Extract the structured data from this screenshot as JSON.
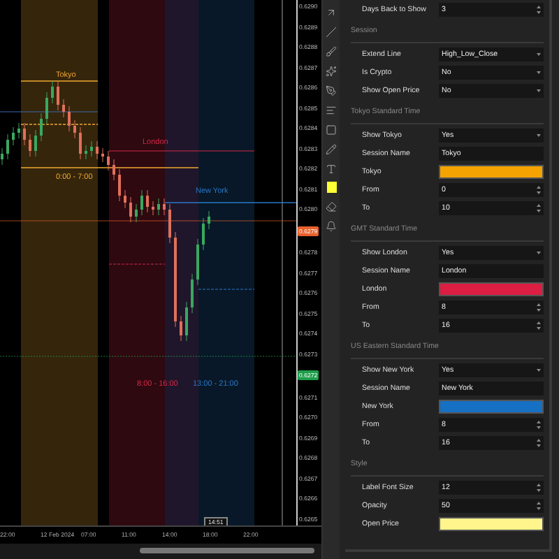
{
  "chart": {
    "sessions": [
      {
        "name": "Tokyo",
        "range": "0:00 - 7:00",
        "color": "#f0a830"
      },
      {
        "name": "London",
        "range": "8:00 - 16:00",
        "color": "#d02848"
      },
      {
        "name": "New York",
        "range": "13:00 - 21:00",
        "color": "#2a78c8"
      }
    ],
    "price_axis": [
      {
        "kind": "tick",
        "text": "0.6290"
      },
      {
        "kind": "tick",
        "text": "0.6289"
      },
      {
        "kind": "tick",
        "text": "0.6288"
      },
      {
        "kind": "tick",
        "text": "0.6287"
      },
      {
        "kind": "tick",
        "text": "0.6286"
      },
      {
        "kind": "tick",
        "text": "0.6285"
      },
      {
        "kind": "tick",
        "text": "0.6284"
      },
      {
        "kind": "tick",
        "text": "0.6283"
      },
      {
        "kind": "tick",
        "text": "0.6282"
      },
      {
        "kind": "tick",
        "text": "0.6281"
      },
      {
        "kind": "tick",
        "text": "0.6280"
      },
      {
        "kind": "badge",
        "text": "0.6279",
        "color": "#e8602c"
      },
      {
        "kind": "tick",
        "text": "0.6278"
      },
      {
        "kind": "tick",
        "text": "0.6277"
      },
      {
        "kind": "tick",
        "text": "0.6276"
      },
      {
        "kind": "tick",
        "text": "0.6275"
      },
      {
        "kind": "tick",
        "text": "0.6274"
      },
      {
        "kind": "tick",
        "text": "0.6273"
      },
      {
        "kind": "badge",
        "text": "0.6272",
        "color": "#1e9e4a"
      },
      {
        "kind": "tick",
        "text": "0.6271"
      },
      {
        "kind": "tick",
        "text": "0.6270"
      },
      {
        "kind": "tick",
        "text": "0.6269"
      },
      {
        "kind": "tick",
        "text": "0.6268"
      },
      {
        "kind": "tick",
        "text": "0.6267"
      },
      {
        "kind": "tick",
        "text": "0.6266"
      },
      {
        "kind": "tick",
        "text": "0.6265"
      }
    ],
    "time_axis": [
      "22:00",
      "12 Feb 2024",
      "07:00",
      "11:00",
      "14:00",
      "18:00",
      "22:00"
    ],
    "cursor_time": "14:51"
  },
  "settings": [
    {
      "kind": "number",
      "label": "Days Back to Show",
      "value": "3"
    },
    {
      "kind": "section",
      "label": "Session"
    },
    {
      "kind": "select",
      "label": "Extend Line",
      "value": "High_Low_Close"
    },
    {
      "kind": "select",
      "label": "Is Crypto",
      "value": "No"
    },
    {
      "kind": "select",
      "label": "Show Open Price",
      "value": "No"
    },
    {
      "kind": "section",
      "label": "Tokyo Standard Time"
    },
    {
      "kind": "select",
      "label": "Show Tokyo",
      "value": "Yes"
    },
    {
      "kind": "text",
      "label": "Session Name",
      "value": "Tokyo"
    },
    {
      "kind": "color",
      "label": "Tokyo",
      "color": "#f5a300"
    },
    {
      "kind": "number",
      "label": "From",
      "value": "0"
    },
    {
      "kind": "number",
      "label": "To",
      "value": "10"
    },
    {
      "kind": "section",
      "label": "GMT Standard Time"
    },
    {
      "kind": "select",
      "label": "Show London",
      "value": "Yes"
    },
    {
      "kind": "text",
      "label": "Session Name",
      "value": "London"
    },
    {
      "kind": "color",
      "label": "London",
      "color": "#dc1e42"
    },
    {
      "kind": "number",
      "label": "From",
      "value": "8"
    },
    {
      "kind": "number",
      "label": "To",
      "value": "16"
    },
    {
      "kind": "section",
      "label": "US Eastern Standard Time"
    },
    {
      "kind": "select",
      "label": "Show New York",
      "value": "Yes"
    },
    {
      "kind": "text",
      "label": "Session Name",
      "value": "New York"
    },
    {
      "kind": "color",
      "label": "New York",
      "color": "#1670c4"
    },
    {
      "kind": "number",
      "label": "From",
      "value": "8"
    },
    {
      "kind": "number",
      "label": "To",
      "value": "16"
    },
    {
      "kind": "section",
      "label": "Style"
    },
    {
      "kind": "number",
      "label": "Label Font Size",
      "value": "12"
    },
    {
      "kind": "number",
      "label": "Opacity",
      "value": "50"
    },
    {
      "kind": "color",
      "label": "Open Price",
      "color": "#fff58c"
    }
  ]
}
